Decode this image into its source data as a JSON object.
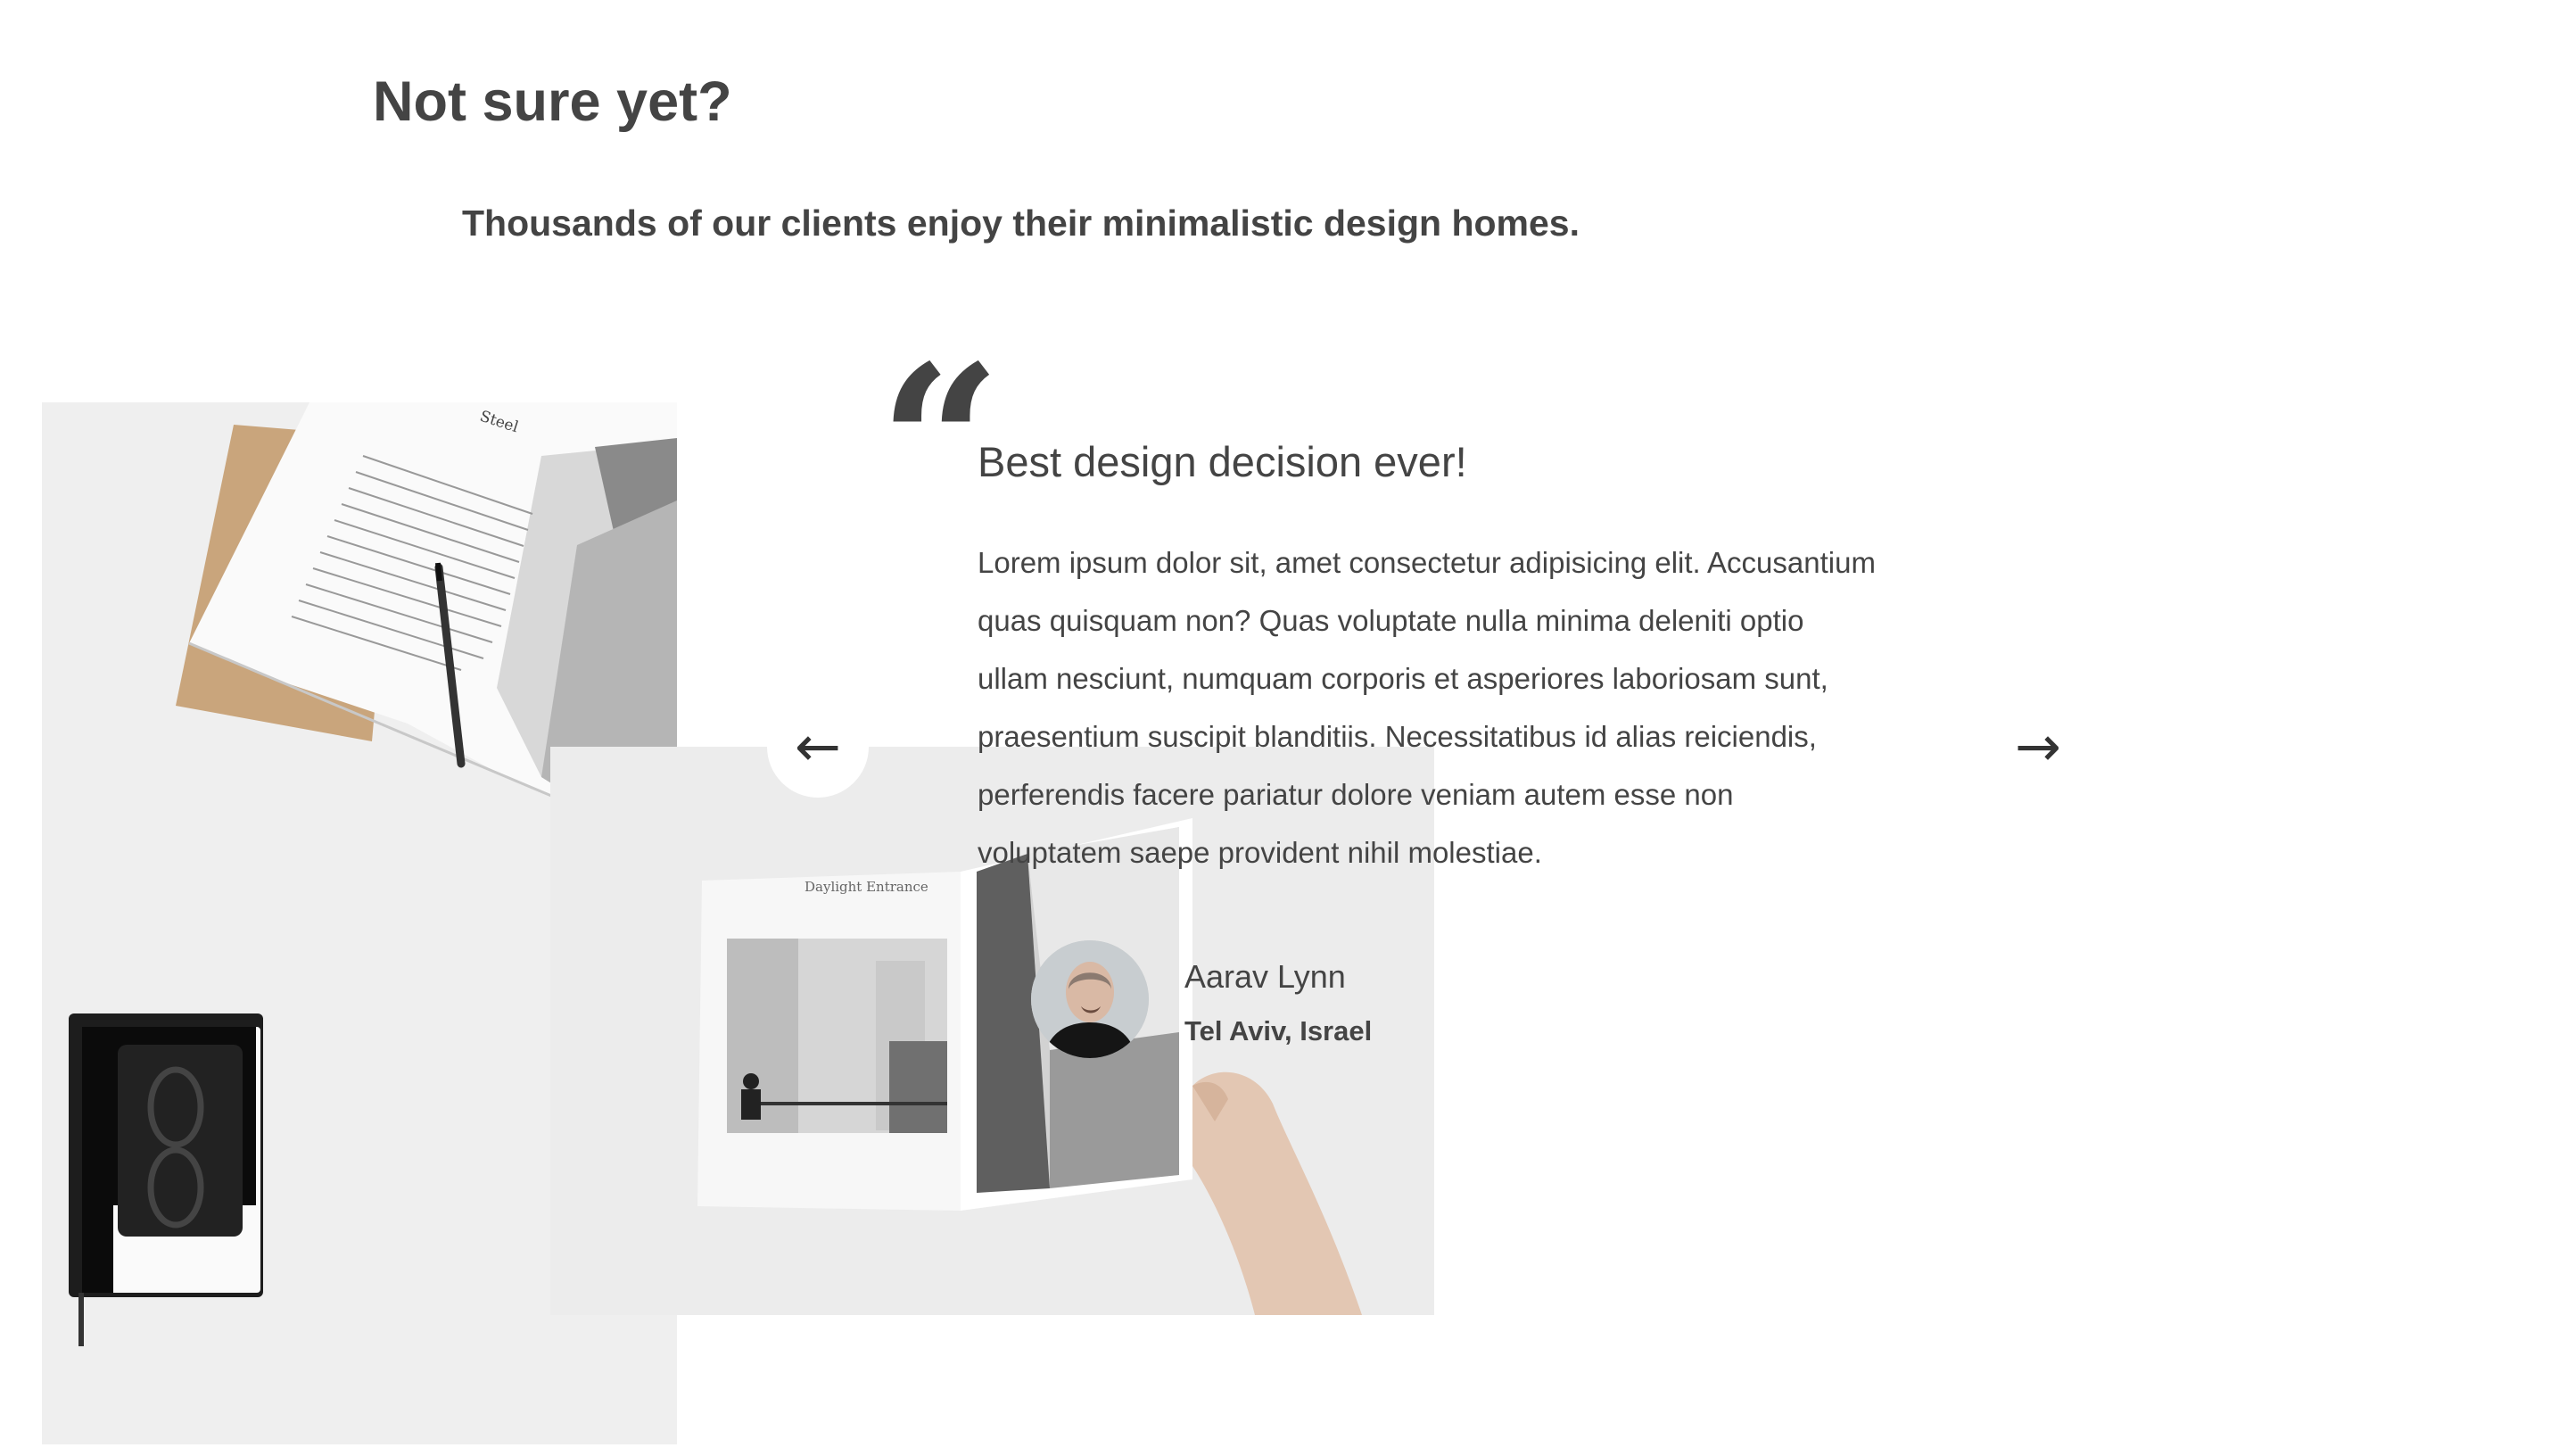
{
  "section": {
    "title": "Not sure yet?",
    "subtitle": "Thousands of our clients enjoy their minimalistic design homes."
  },
  "testimonial": {
    "quote_mark": "“",
    "heading": "Best design decision ever!",
    "body": "Lorem ipsum dolor sit, amet consectetur adipisicing elit. Accusantium quas quisquam non? Quas voluptate nulla minima deleniti optio ullam nesciunt, numquam corporis et asperiores laboriosam sunt, praesentium suscipit blanditiis. Necessitatibus id alias reiciendis, perferendis facere pariatur dolore veniam autem esse non voluptatem saepe provident nihil molestiae.",
    "author": {
      "name": "Aarav Lynn",
      "location": "Tel Aviv, Israel"
    }
  },
  "nav": {
    "prev_icon": "arrow-left-icon",
    "next_icon": "arrow-right-icon",
    "prev_glyph": "←",
    "next_glyph": "→"
  },
  "images": {
    "photo1_book_title": "Steel",
    "photo2_book_title": "Daylight Entrance"
  },
  "colors": {
    "text": "#444444",
    "background": "#ffffff",
    "photo_bg": "#efefef"
  }
}
